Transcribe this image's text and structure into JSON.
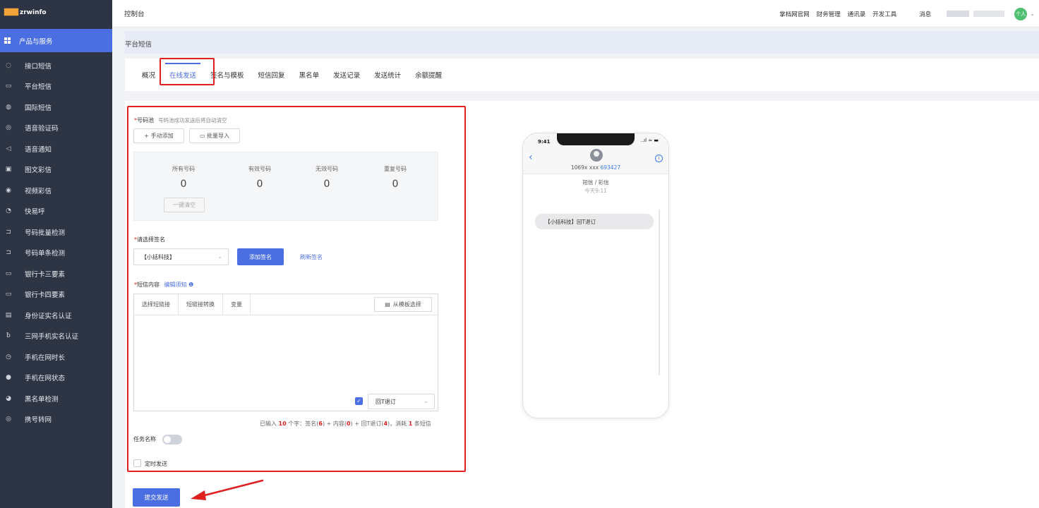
{
  "app": {
    "logo": "zrwinfo",
    "logo_mark": "🏿🏿",
    "console_title": "控制台"
  },
  "top_nav": {
    "links": [
      "掌档网官网",
      "财务管理",
      "通讯录",
      "开发工具"
    ],
    "message": "消息",
    "avatar": "个人"
  },
  "sidebar": {
    "product_label": "产品与服务",
    "items": [
      {
        "icon": "chat-icon",
        "glyph": "◌",
        "label": "接口短信"
      },
      {
        "icon": "message-icon",
        "glyph": "▭",
        "label": "平台短信"
      },
      {
        "icon": "globe-icon",
        "glyph": "◍",
        "label": "国际短信"
      },
      {
        "icon": "voice-icon",
        "glyph": "◎",
        "label": "语音验证码"
      },
      {
        "icon": "speaker-icon",
        "glyph": "◁",
        "label": "语音通知"
      },
      {
        "icon": "image-icon",
        "glyph": "▣",
        "label": "图文彩信"
      },
      {
        "icon": "video-icon",
        "glyph": "◉",
        "label": "视频彩信"
      },
      {
        "icon": "call-icon",
        "glyph": "◔",
        "label": "快易呼"
      },
      {
        "icon": "batch-check-icon",
        "glyph": "⊐",
        "label": "号码批量检测"
      },
      {
        "icon": "single-check-icon",
        "glyph": "⊐",
        "label": "号码单条检测"
      },
      {
        "icon": "card-icon",
        "glyph": "▭",
        "label": "银行卡三要素"
      },
      {
        "icon": "card-icon",
        "glyph": "▭",
        "label": "银行卡四要素"
      },
      {
        "icon": "id-card-icon",
        "glyph": "▤",
        "label": "身份证实名认证"
      },
      {
        "icon": "user-icon",
        "glyph": "ƀ",
        "label": "三网手机实名认证"
      },
      {
        "icon": "clock-icon",
        "glyph": "◷",
        "label": "手机在网时长"
      },
      {
        "icon": "status-icon",
        "glyph": "●",
        "label": "手机在网状态"
      },
      {
        "icon": "blacklist-icon",
        "glyph": "◕",
        "label": "黑名单检测"
      },
      {
        "icon": "transfer-icon",
        "glyph": "◎",
        "label": "携号转网"
      }
    ]
  },
  "breadcrumb": "平台短信",
  "tabs": [
    {
      "label": "概况"
    },
    {
      "label": "在线发送"
    },
    {
      "label": "签名与模板"
    },
    {
      "label": "短信回复"
    },
    {
      "label": "黑名单"
    },
    {
      "label": "发送记录"
    },
    {
      "label": "发送统计"
    },
    {
      "label": "余额提醒"
    }
  ],
  "form": {
    "pool_label": "号码池",
    "pool_hint": "号码池成功发送后将自动清空",
    "manual_add": "+ 手动添加",
    "batch_import": "▭ 批量导入",
    "stats": [
      {
        "label": "所有号码",
        "value": "0"
      },
      {
        "label": "有效号码",
        "value": "0"
      },
      {
        "label": "无效号码",
        "value": "0"
      },
      {
        "label": "重复号码",
        "value": "0"
      }
    ],
    "clear_button": "一键清空",
    "signature_label": "请选择签名",
    "signature_value": "【小括科技】",
    "add_signature": "添加签名",
    "refresh_signature": "刷新签名",
    "content_label": "短信内容",
    "edit_notice": "编辑须知",
    "toolbar": [
      "选择短链接",
      "短链接转换",
      "变量"
    ],
    "template_select": "从模板选择",
    "unsubscribe_value": "回T退订",
    "count_text": {
      "p1": "已输入 ",
      "n1": "10",
      "p2": " 个字：签名(",
      "n2": "6",
      "p3": ") + 内容(",
      "n3": "0",
      "p4": ") + 回T退订(",
      "n4": "4",
      "p5": ")，消耗 ",
      "n5": "1",
      "p6": " 条短信"
    },
    "task_name_label": "任务名称",
    "scheduled_label": "定时发送",
    "submit": "提交发送"
  },
  "phone": {
    "time": "9:41",
    "signal": "..ıl ≈ ▬",
    "number_prefix": "1069x xxx ",
    "number_suffix": "693427",
    "type": "短信 / 彩信",
    "time_label": "今天9:11",
    "bubble": "【小括科技】回T退订"
  },
  "colors": {
    "primary": "#4b6ee3",
    "sidebar": "#2d3443",
    "highlight": "#e02020"
  }
}
